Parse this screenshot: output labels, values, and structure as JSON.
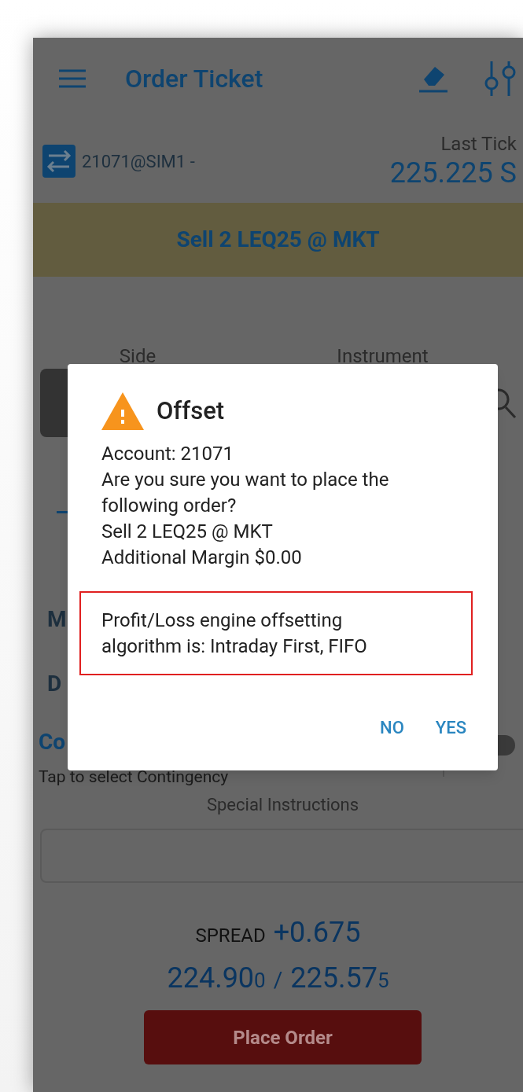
{
  "header": {
    "title": "Order Ticket"
  },
  "account": {
    "label": "21071@SIM1 -"
  },
  "last_tick": {
    "label": "Last Tick",
    "value": "225.225 S"
  },
  "order_summary": "Sell 2 LEQ25 @ MKT",
  "columns": {
    "side_label": "Side",
    "instrument_label": "Instrument"
  },
  "partial_labels": [
    "M",
    "D"
  ],
  "contingency": {
    "label": "Co",
    "hint": "Tap to select Contingency",
    "toggle_on": false
  },
  "special_instructions": {
    "label": "Special Instructions"
  },
  "spread": {
    "label": "SPREAD",
    "value": "+0.675"
  },
  "quote": {
    "bid": "224.90",
    "bid_last_digit": "0",
    "separator": "/",
    "ask": "225.57",
    "ask_last_digit": "5"
  },
  "place_order": "Place Order",
  "dialog": {
    "title": "Offset",
    "message_lines": [
      "Account: 21071",
      "Are you sure you want to place the following order?",
      "Sell 2 LEQ25 @ MKT",
      "Additional Margin $0.00"
    ],
    "notice": "Profit/Loss engine offsetting algorithm is: Intraday First, FIFO",
    "buttons": [
      "NO",
      "YES"
    ]
  }
}
